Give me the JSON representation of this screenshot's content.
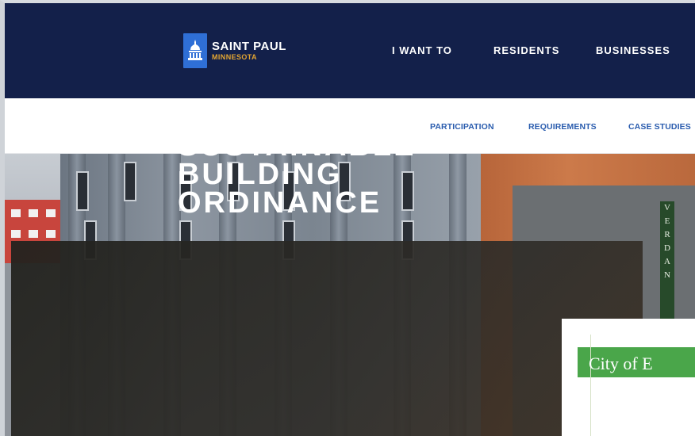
{
  "brand": {
    "city": "SAINT PAUL",
    "state": "MINNESOTA"
  },
  "main_nav": [
    "I WANT TO",
    "RESIDENTS",
    "BUSINESSES"
  ],
  "sub_nav": [
    "PARTICIPATION",
    "REQUIREMENTS",
    "CASE STUDIES"
  ],
  "hero": {
    "title_line1": "SUSTAINABLE",
    "title_line2": "BUILDING",
    "title_line3": "ORDINANCE"
  },
  "sign_letters": [
    "V",
    "E",
    "R",
    "D",
    "A",
    "N"
  ],
  "card": {
    "text": "City of E"
  },
  "colors": {
    "nav_bg": "#13204a",
    "logo_blue": "#2f6fd6",
    "logo_gold": "#e3a532",
    "subnav_link": "#2a5cae",
    "card_green": "#4aa64a"
  }
}
